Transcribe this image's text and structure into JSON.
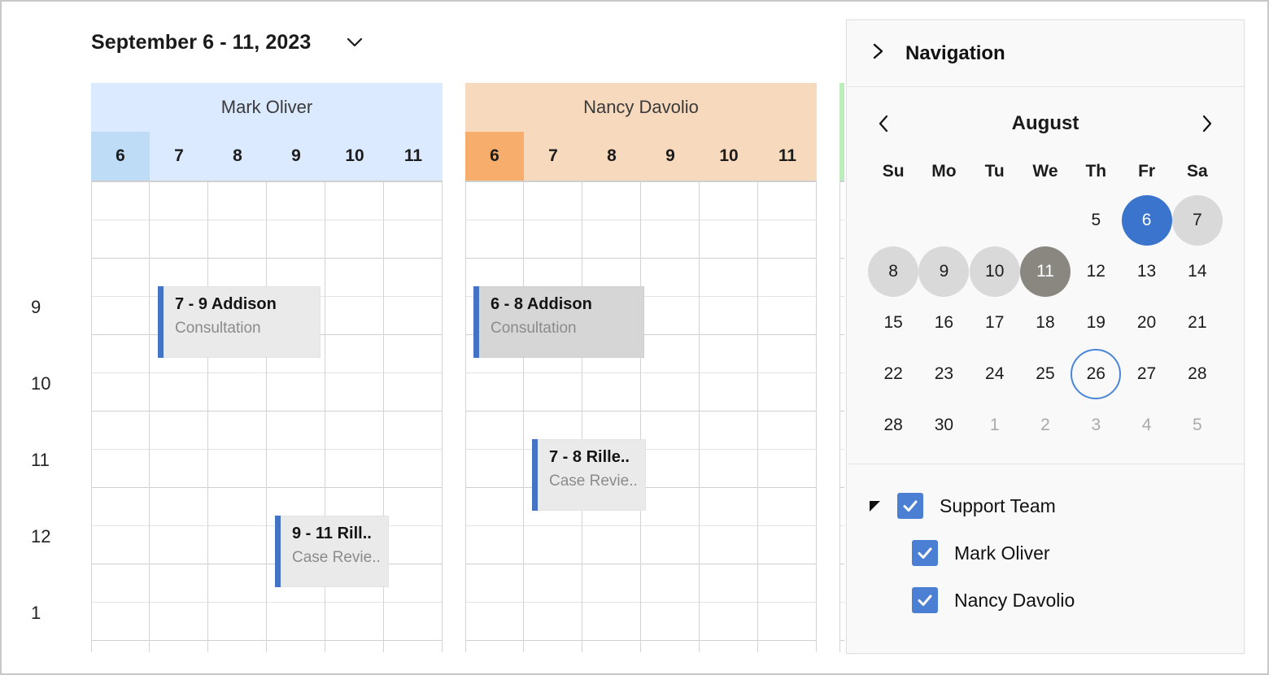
{
  "toolbar": {
    "title": "September 6 - 11, 2023",
    "dropdown_icon": "chevron-down-icon"
  },
  "scheduler": {
    "time_labels": [
      "9",
      "10",
      "11",
      "12",
      "1"
    ],
    "day_numbers": [
      "6",
      "7",
      "8",
      "9",
      "10",
      "11"
    ],
    "groups": [
      {
        "name": "Mark Oliver",
        "header_color": "#dbeafe",
        "highlight_color": "#bfdcf7",
        "highlighted_day": "6",
        "events": [
          {
            "title": "7 - 9 Addison",
            "subtitle": "Consultation",
            "bar_color": "#4472c4",
            "selected": false
          },
          {
            "title": "9 - 11 Rill..",
            "subtitle": "Case Revie..",
            "bar_color": "#4472c4",
            "selected": false
          }
        ]
      },
      {
        "name": "Nancy Davolio",
        "header_color": "#f7d9be",
        "highlight_color": "#f7ad6b",
        "highlighted_day": "6",
        "events": [
          {
            "title": "6 - 8 Addison",
            "subtitle": "Consultation",
            "bar_color": "#4472c4",
            "selected": true
          },
          {
            "title": "7 - 8 Rille..",
            "subtitle": "Case Revie..",
            "bar_color": "#4472c4",
            "selected": false
          }
        ]
      },
      {
        "name": "",
        "header_color": "#bdecbd",
        "highlight_color": "#96d396",
        "highlighted_day": "",
        "events": []
      }
    ]
  },
  "navigation": {
    "header_label": "Navigation",
    "expand_icon": "chevron-right-icon",
    "mini_calendar": {
      "month": "August",
      "prev_icon": "chevron-left-icon",
      "next_icon": "chevron-right-icon",
      "day_names": [
        "Su",
        "Mo",
        "Tu",
        "We",
        "Th",
        "Fr",
        "Sa"
      ],
      "weeks": [
        [
          {
            "label": "",
            "state": "empty"
          },
          {
            "label": "",
            "state": "empty"
          },
          {
            "label": "",
            "state": "empty"
          },
          {
            "label": "",
            "state": "empty"
          },
          {
            "label": "5",
            "state": "normal"
          },
          {
            "label": "6",
            "state": "selected"
          },
          {
            "label": "7",
            "state": "range"
          }
        ],
        [
          {
            "label": "8",
            "state": "range"
          },
          {
            "label": "9",
            "state": "range"
          },
          {
            "label": "10",
            "state": "range"
          },
          {
            "label": "11",
            "state": "hover"
          },
          {
            "label": "12",
            "state": "normal"
          },
          {
            "label": "13",
            "state": "normal"
          },
          {
            "label": "14",
            "state": "normal"
          }
        ],
        [
          {
            "label": "15",
            "state": "normal"
          },
          {
            "label": "16",
            "state": "normal"
          },
          {
            "label": "17",
            "state": "normal"
          },
          {
            "label": "18",
            "state": "normal"
          },
          {
            "label": "19",
            "state": "normal"
          },
          {
            "label": "20",
            "state": "normal"
          },
          {
            "label": "21",
            "state": "normal"
          }
        ],
        [
          {
            "label": "22",
            "state": "normal"
          },
          {
            "label": "23",
            "state": "normal"
          },
          {
            "label": "24",
            "state": "normal"
          },
          {
            "label": "25",
            "state": "normal"
          },
          {
            "label": "26",
            "state": "today"
          },
          {
            "label": "27",
            "state": "normal"
          },
          {
            "label": "28",
            "state": "normal"
          }
        ],
        [
          {
            "label": "28",
            "state": "normal"
          },
          {
            "label": "30",
            "state": "normal"
          },
          {
            "label": "1",
            "state": "other"
          },
          {
            "label": "2",
            "state": "other"
          },
          {
            "label": "3",
            "state": "other"
          },
          {
            "label": "4",
            "state": "other"
          },
          {
            "label": "5",
            "state": "other"
          }
        ]
      ],
      "colors": {
        "selected_bg": "#3a74cd",
        "range_bg": "#d9d9d9",
        "hover_bg": "#8a8781",
        "today_border": "#4a86d8"
      }
    },
    "resource_tree": {
      "group": {
        "label": "Support Team",
        "checked": true,
        "expanded": true
      },
      "children": [
        {
          "label": "Mark Oliver",
          "checked": true
        },
        {
          "label": "Nancy Davolio",
          "checked": true
        }
      ],
      "checkbox_color": "#4a7fd4"
    }
  }
}
